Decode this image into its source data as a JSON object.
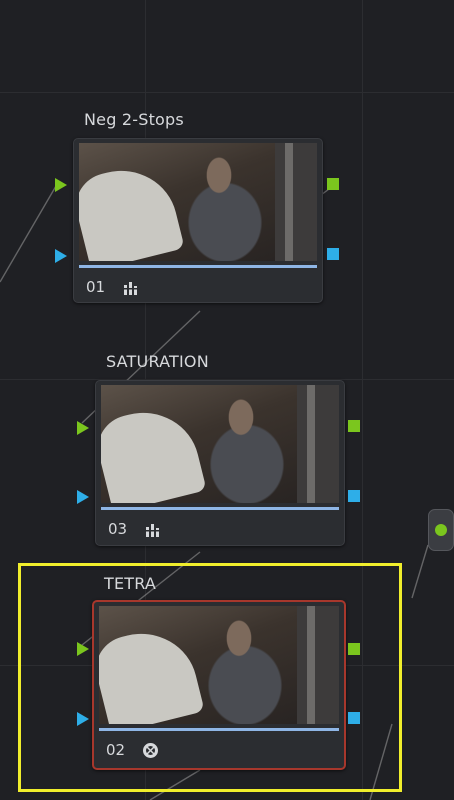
{
  "nodes": [
    {
      "title": "Neg 2-Stops",
      "number": "01",
      "tool_icon": "bars-icon"
    },
    {
      "title": "SATURATION",
      "number": "03",
      "tool_icon": "bars-icon"
    },
    {
      "title": "TETRA",
      "number": "02",
      "tool_icon": "scope-icon"
    }
  ],
  "colors": {
    "background": "#1f2024",
    "rgb_input": "#7bc61e",
    "alpha_input": "#2eaee8",
    "selection": "#f0ee2c",
    "selected_node_border": "#a7372c",
    "progress": "#8fb6e6"
  },
  "output_node": {
    "icon": "output-dot-icon"
  }
}
